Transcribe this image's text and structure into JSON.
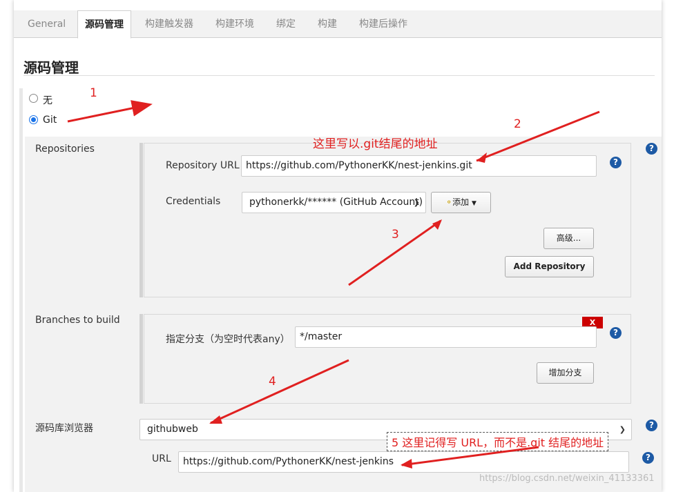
{
  "tabs": [
    "General",
    "源码管理",
    "构建触发器",
    "构建环境",
    "绑定",
    "构建",
    "构建后操作"
  ],
  "section_title": "源码管理",
  "scm": {
    "none_label": "无",
    "git_label": "Git"
  },
  "repositories": {
    "label": "Repositories",
    "url_label": "Repository URL",
    "url_value": "https://github.com/PythonerKK/nest-jenkins.git",
    "credentials_label": "Credentials",
    "credentials_value": "pythonerkk/****** (GitHub Account)",
    "add_button": "添加",
    "advanced_button": "高级...",
    "add_repo_button": "Add Repository"
  },
  "branches": {
    "label": "Branches to build",
    "field_label": "指定分支（为空时代表any）",
    "field_value": "*/master",
    "delete_button": "X",
    "add_branch_button": "增加分支"
  },
  "browser": {
    "label": "源码库浏览器",
    "value": "githubweb",
    "url_label": "URL",
    "url_value": "https://github.com/PythonerKK/nest-jenkins"
  },
  "help_symbol": "?",
  "annotations": {
    "n1": "1",
    "n2": "2",
    "n3": "3",
    "n4": "4",
    "text2": "这里写以.git结尾的地址",
    "text5": "5 这里记得写 URL，而不是.git 结尾的地址"
  },
  "watermark": "https://blog.csdn.net/weixin_41133361",
  "colors": {
    "annotation": "#e02020",
    "help": "#1d5aa5",
    "radio_checked": "#1a73e8",
    "delete": "#cc0000"
  }
}
